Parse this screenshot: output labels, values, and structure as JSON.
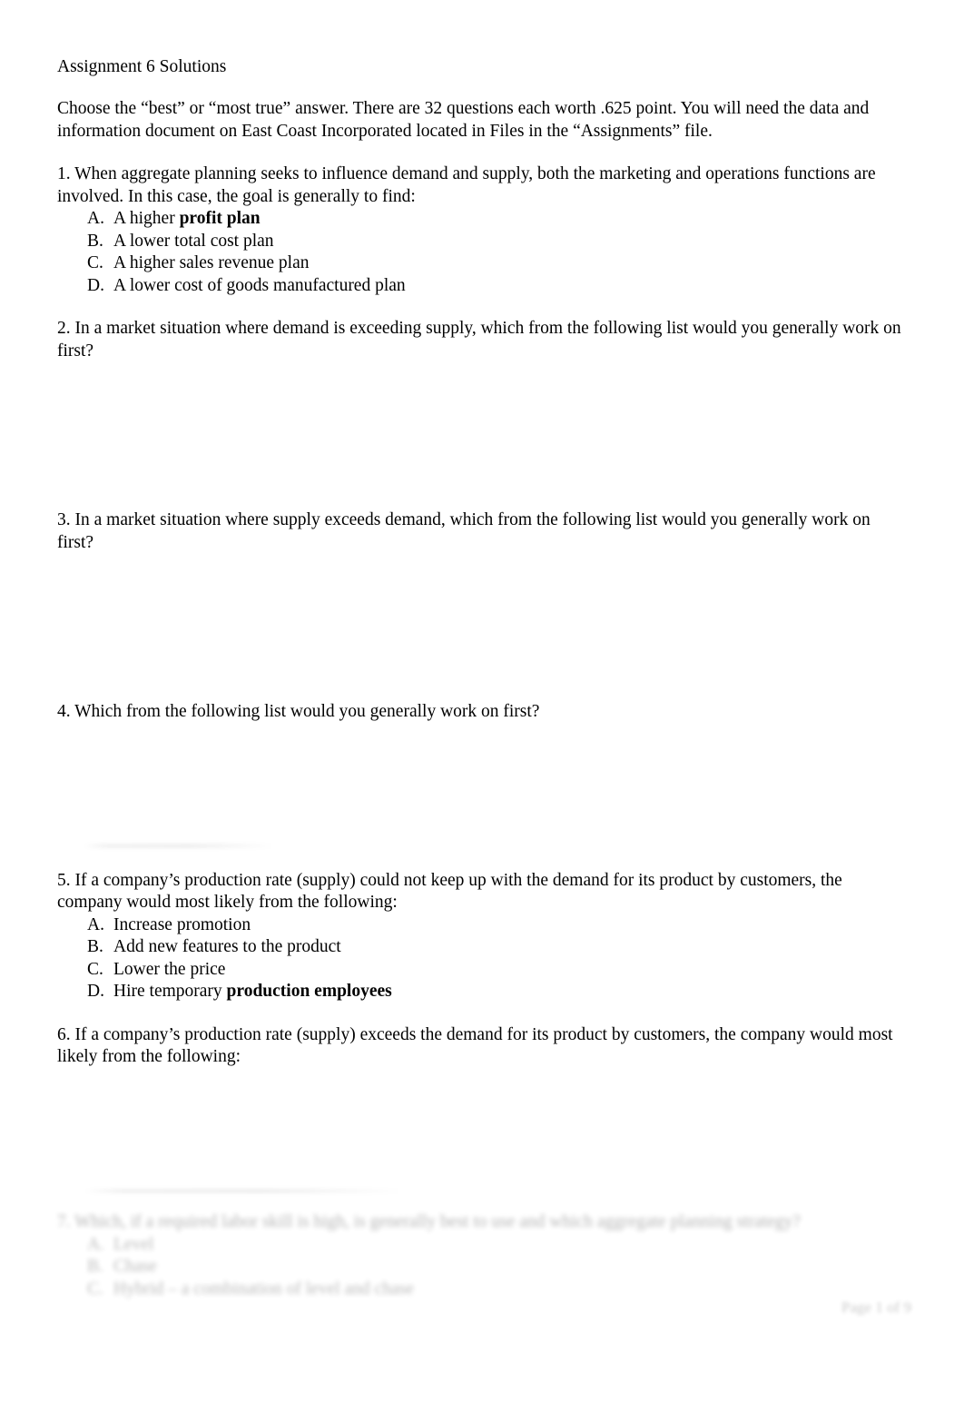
{
  "document": {
    "title": "Assignment 6 Solutions",
    "intro": "Choose the “best” or “most true” answer.  There are 32 questions each worth .625 point.  You will need the data and information document on East Coast Incorporated located in Files in the “Assignments” file.",
    "footer": "Page 1 of 9"
  },
  "questions": [
    {
      "number": "1.",
      "text": "1.  When aggregate planning seeks to influence demand and supply, both the marketing and operations functions are involved.  In this case, the goal is generally to find:",
      "options": [
        {
          "letter": "A.",
          "pre": "A higher ",
          "bold": "profit plan",
          "post": ""
        },
        {
          "letter": "B.",
          "pre": "A lower total cost plan",
          "bold": "",
          "post": ""
        },
        {
          "letter": "C.",
          "pre": "A higher sales revenue plan",
          "bold": "",
          "post": ""
        },
        {
          "letter": "D.",
          "pre": "A lower cost of goods manufactured plan",
          "bold": "",
          "post": ""
        }
      ]
    },
    {
      "number": "2.",
      "text": "2.  In a market situation where demand is exceeding supply, which from the following list would you generally work on first?",
      "options": []
    },
    {
      "number": "3.",
      "text": "3.  In a market situation where supply exceeds demand, which from the following list would you generally work on first?",
      "options": []
    },
    {
      "number": "4.",
      "text": "4.  Which from the following list would you generally work on first?",
      "options": []
    },
    {
      "number": "5.",
      "text": "5.  If a company’s production rate (supply) could not keep up with the demand for its product by customers, the company would most likely from the following:",
      "options": [
        {
          "letter": "A.",
          "pre": "Increase promotion",
          "bold": "",
          "post": ""
        },
        {
          "letter": "B.",
          "pre": "Add new features to the product",
          "bold": "",
          "post": ""
        },
        {
          "letter": "C.",
          "pre": "Lower the price",
          "bold": "",
          "post": ""
        },
        {
          "letter": "D.",
          "pre": "Hire temporary ",
          "bold": "production employees",
          "post": ""
        }
      ]
    },
    {
      "number": "6.",
      "text": "6.  If a company’s production rate (supply) exceeds the demand for its product by customers, the company would most likely from the following:",
      "options": []
    },
    {
      "number": "7.",
      "text": "7.  Which, if a required labor skill is high, is generally best to use and which aggregate planning strategy?",
      "options": [
        {
          "letter": "A.",
          "pre": "Level",
          "bold": "",
          "post": ""
        },
        {
          "letter": "B.",
          "pre": "Chase",
          "bold": "",
          "post": ""
        },
        {
          "letter": "C.",
          "pre": "Hybrid – a combination of level and chase",
          "bold": "",
          "post": ""
        }
      ]
    }
  ]
}
